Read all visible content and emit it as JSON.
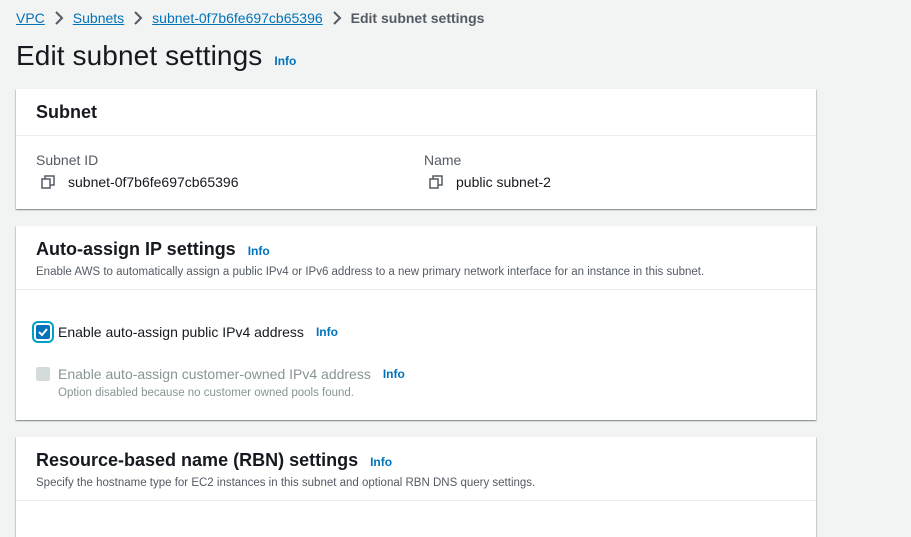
{
  "breadcrumb": {
    "vpc": "VPC",
    "subnets": "Subnets",
    "subnet_id": "subnet-0f7b6fe697cb65396",
    "current": "Edit subnet settings"
  },
  "page": {
    "title": "Edit subnet settings",
    "info": "Info"
  },
  "subnet_panel": {
    "title": "Subnet",
    "subnet_id_label": "Subnet ID",
    "subnet_id_value": "subnet-0f7b6fe697cb65396",
    "name_label": "Name",
    "name_value": "public subnet-2"
  },
  "auto_assign_panel": {
    "title": "Auto-assign IP settings",
    "info": "Info",
    "description": "Enable AWS to automatically assign a public IPv4 or IPv6 address to a new primary network interface for an instance in this subnet.",
    "ipv4_label": "Enable auto-assign public IPv4 address",
    "ipv4_info": "Info",
    "ipv4_checked": true,
    "customer_owned_label": "Enable auto-assign customer-owned IPv4 address",
    "customer_owned_info": "Info",
    "customer_owned_hint": "Option disabled because no customer owned pools found."
  },
  "rbn_panel": {
    "title": "Resource-based name (RBN) settings",
    "info": "Info",
    "description": "Specify the hostname type for EC2 instances in this subnet and optional RBN DNS query settings."
  },
  "colors": {
    "link": "#0073bb",
    "background": "#f2f3f3",
    "panel": "#ffffff",
    "checkbox_checked": "#0073bb",
    "checkbox_disabled": "#d5dbdb"
  }
}
